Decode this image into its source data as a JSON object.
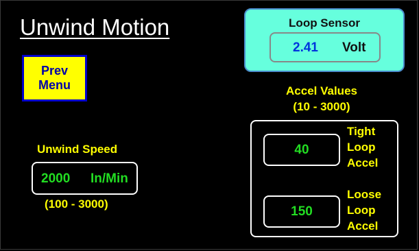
{
  "screen": {
    "title": "Unwind Motion"
  },
  "prev_menu": {
    "label": "Prev\nMenu"
  },
  "loop_sensor": {
    "title": "Loop Sensor",
    "value": "2.41",
    "unit": "Volt"
  },
  "accel": {
    "heading": "Accel Values",
    "range": "(10 - 3000)",
    "tight": {
      "value": "40",
      "label": "Tight\nLoop\nAccel"
    },
    "loose": {
      "value": "150",
      "label": "Loose\nLoop\nAccel"
    }
  },
  "unwind_speed": {
    "label": "Unwind Speed",
    "value": "2000",
    "unit": "In/Min",
    "range": "(100 - 3000)"
  },
  "colors": {
    "background": "#000000",
    "label_yellow": "#ffff00",
    "value_green": "#22dd22",
    "sensor_panel": "#66ffdd",
    "sensor_value_blue": "#0033dd",
    "button_yellow": "#ffff00",
    "button_border_blue": "#0000cc"
  }
}
